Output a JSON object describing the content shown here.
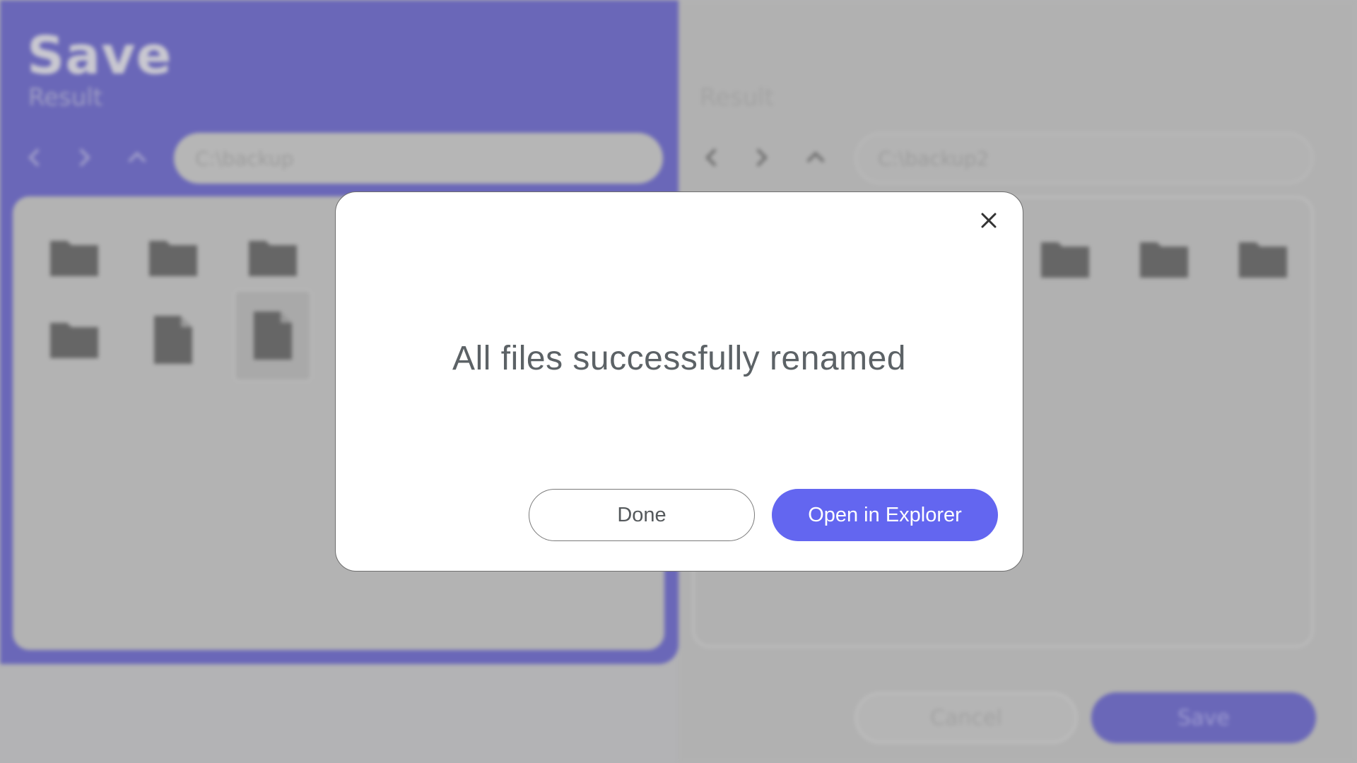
{
  "app": {
    "title": "Save",
    "left_pane": {
      "subtitle": "Result",
      "path": "C:\\backup",
      "items": [
        {
          "type": "folder"
        },
        {
          "type": "folder"
        },
        {
          "type": "folder"
        },
        {
          "type": "folder"
        },
        {
          "type": "file"
        },
        {
          "type": "file",
          "selected": true
        }
      ]
    },
    "right_pane": {
      "subtitle": "Result",
      "path": "C:\\backup2",
      "items": [
        {
          "type": "folder"
        },
        {
          "type": "folder"
        },
        {
          "type": "folder"
        }
      ]
    },
    "cancel_label": "Cancel",
    "save_label": "Save"
  },
  "dialog": {
    "message": "All files successfully renamed",
    "done_label": "Done",
    "open_label": "Open in Explorer",
    "close_icon": "close-icon"
  },
  "colors": {
    "accent": "#6366f0",
    "pane_accent": "#6a67b8",
    "dialog_bg": "#ffffff",
    "message_text": "#5c6266"
  }
}
